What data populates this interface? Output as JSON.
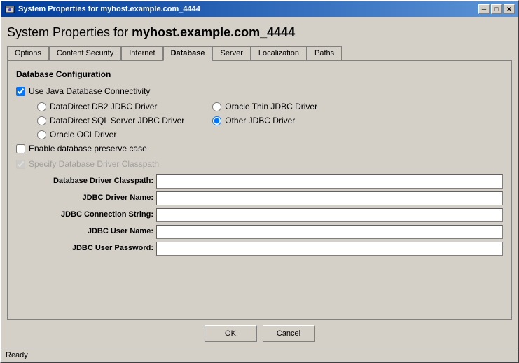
{
  "window": {
    "title": "System Properties for myhost.example.com_4444",
    "title_icon": "gear"
  },
  "header": {
    "title_prefix": "System Properties for",
    "hostname": "myhost.example.com_4444"
  },
  "tabs": [
    {
      "label": "Options",
      "active": false
    },
    {
      "label": "Content Security",
      "active": false
    },
    {
      "label": "Internet",
      "active": false
    },
    {
      "label": "Database",
      "active": true
    },
    {
      "label": "Server",
      "active": false
    },
    {
      "label": "Localization",
      "active": false
    },
    {
      "label": "Paths",
      "active": false
    }
  ],
  "section": {
    "title": "Database Configuration",
    "use_jdbc_label": "Use Java Database Connectivity",
    "use_jdbc_checked": true,
    "drivers": {
      "left": [
        {
          "label": "DataDirect DB2 JDBC Driver",
          "selected": false
        },
        {
          "label": "DataDirect SQL Server JDBC Driver",
          "selected": false
        },
        {
          "label": "Oracle OCI Driver",
          "selected": false
        }
      ],
      "right": [
        {
          "label": "Oracle Thin JDBC Driver",
          "selected": false
        },
        {
          "label": "Other JDBC Driver",
          "selected": true
        }
      ]
    },
    "preserve_case_label": "Enable database preserve case",
    "preserve_case_checked": false,
    "classpath_label": "Specify Database Driver Classpath",
    "classpath_checked": true,
    "classpath_disabled": true,
    "fields": [
      {
        "label": "Database Driver Classpath:",
        "value": "",
        "name": "classpath"
      },
      {
        "label": "JDBC Driver Name:",
        "value": "",
        "name": "driver-name"
      },
      {
        "label": "JDBC Connection String:",
        "value": "",
        "name": "connection-string"
      },
      {
        "label": "JDBC User Name:",
        "value": "",
        "name": "user-name"
      },
      {
        "label": "JDBC User Password:",
        "value": "",
        "name": "user-password"
      }
    ]
  },
  "buttons": {
    "ok": "OK",
    "cancel": "Cancel"
  },
  "status": {
    "text": "Ready"
  },
  "title_controls": {
    "minimize": "─",
    "maximize": "□",
    "close": "✕"
  }
}
